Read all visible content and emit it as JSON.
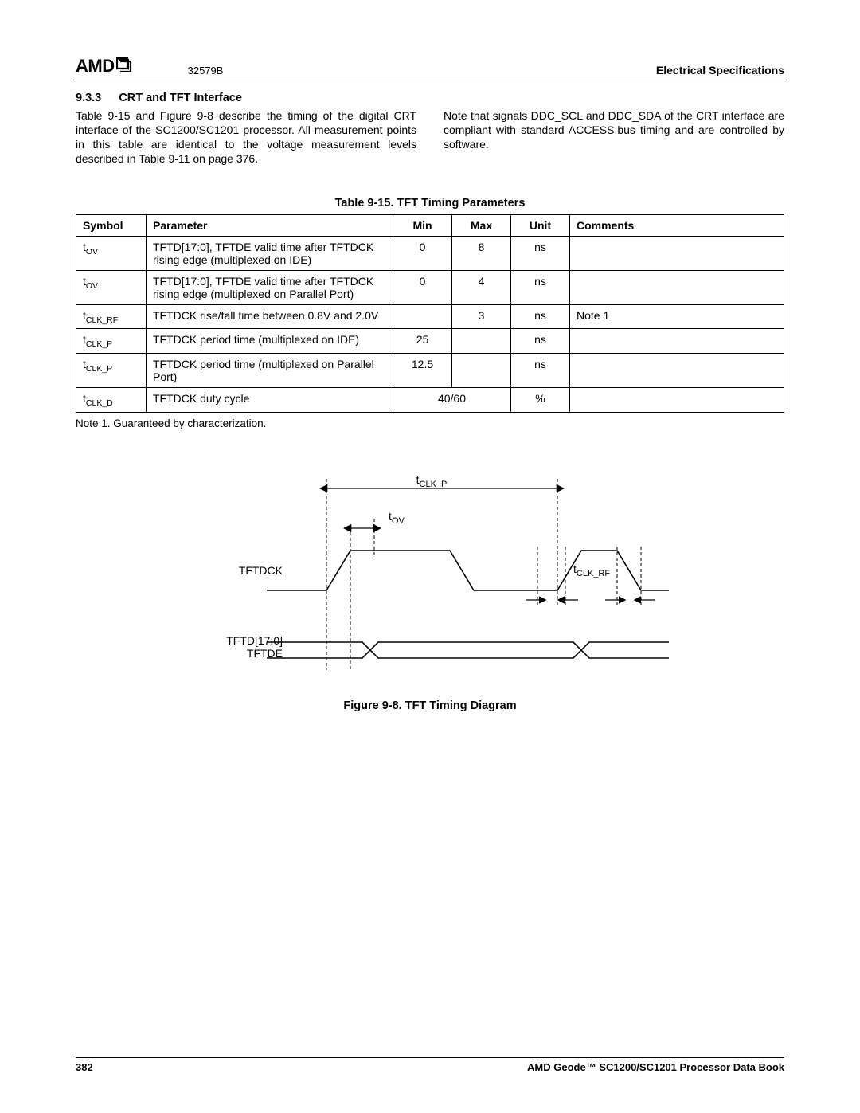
{
  "header": {
    "logo_text": "AMD",
    "doc_number": "32579B",
    "right": "Electrical Specifications"
  },
  "section": {
    "number": "9.3.3",
    "title": "CRT and TFT Interface"
  },
  "paragraphs": {
    "left": "Table 9-15 and Figure  9-8 describe the timing of the digital CRT interface of the SC1200/SC1201 processor. All measurement points in this table are identical to the voltage measurement levels described in Table 9-11 on page 376.",
    "right": "Note that signals DDC_SCL and DDC_SDA of the CRT interface are compliant with standard ACCESS.bus timing and are controlled by software."
  },
  "table": {
    "caption": "Table 9-15.  TFT Timing Parameters",
    "headers": {
      "symbol": "Symbol",
      "parameter": "Parameter",
      "min": "Min",
      "max": "Max",
      "unit": "Unit",
      "comments": "Comments"
    },
    "rows": [
      {
        "sym_base": "t",
        "sym_sub": "OV",
        "param": "TFTD[17:0], TFTDE valid time after TFTDCK rising edge (multiplexed on IDE)",
        "min": "0",
        "max": "8",
        "unit": "ns",
        "comments": "",
        "span": false
      },
      {
        "sym_base": "t",
        "sym_sub": "OV",
        "param": "TFTD[17:0], TFTDE valid time after TFTDCK rising edge (multiplexed on Parallel Port)",
        "min": "0",
        "max": "4",
        "unit": "ns",
        "comments": "",
        "span": false
      },
      {
        "sym_base": "t",
        "sym_sub": "CLK_RF",
        "param": "TFTDCK rise/fall time between 0.8V and 2.0V",
        "min": "",
        "max": "3",
        "unit": "ns",
        "comments": "Note 1",
        "span": false
      },
      {
        "sym_base": "t",
        "sym_sub": "CLK_P",
        "param": "TFTDCK period time (multiplexed on IDE)",
        "min": "25",
        "max": "",
        "unit": "ns",
        "comments": "",
        "span": false
      },
      {
        "sym_base": "t",
        "sym_sub": "CLK_P",
        "param": "TFTDCK period time (multiplexed on Parallel Port)",
        "min": "12.5",
        "max": "",
        "unit": "ns",
        "comments": "",
        "span": false
      },
      {
        "sym_base": "t",
        "sym_sub": "CLK_D",
        "param": "TFTDCK duty cycle",
        "min": "40/60",
        "max": "",
        "unit": "%",
        "comments": "",
        "span": true
      }
    ],
    "note": "Note 1.   Guaranteed by characterization."
  },
  "figure": {
    "caption": "Figure 9-8.  TFT Timing Diagram",
    "labels": {
      "tclkp": "CLK_P",
      "tov": "OV",
      "tclkrf": "CLK_RF",
      "tftdck": "TFTDCK",
      "tftd": "TFTD[17:0]",
      "tftde": "TFTDE",
      "t_prefix": "t"
    }
  },
  "footer": {
    "page": "382",
    "title": "AMD Geode™ SC1200/SC1201 Processor Data Book"
  }
}
